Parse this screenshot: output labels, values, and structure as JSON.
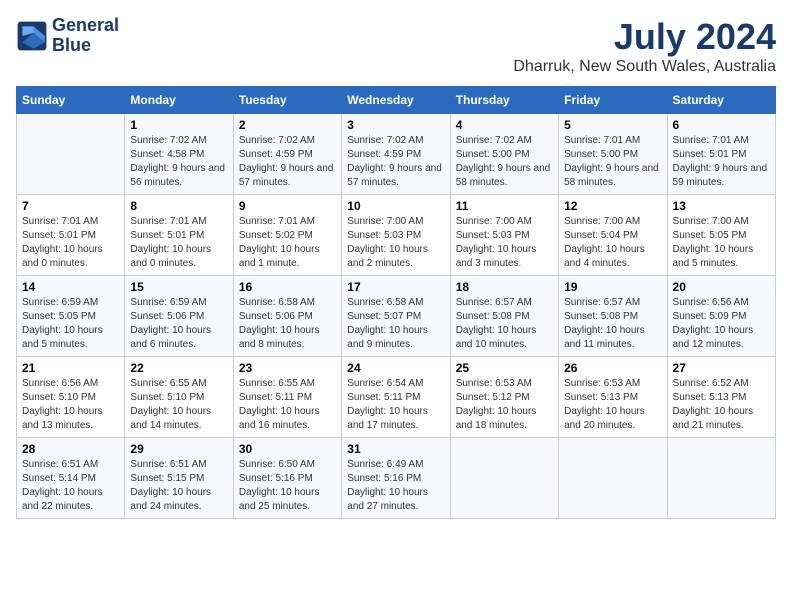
{
  "header": {
    "logo_line1": "General",
    "logo_line2": "Blue",
    "month_title": "July 2024",
    "location": "Dharruk, New South Wales, Australia"
  },
  "weekdays": [
    "Sunday",
    "Monday",
    "Tuesday",
    "Wednesday",
    "Thursday",
    "Friday",
    "Saturday"
  ],
  "weeks": [
    [
      {
        "day": "",
        "sunrise": "",
        "sunset": "",
        "daylight": ""
      },
      {
        "day": "1",
        "sunrise": "Sunrise: 7:02 AM",
        "sunset": "Sunset: 4:58 PM",
        "daylight": "Daylight: 9 hours and 56 minutes."
      },
      {
        "day": "2",
        "sunrise": "Sunrise: 7:02 AM",
        "sunset": "Sunset: 4:59 PM",
        "daylight": "Daylight: 9 hours and 57 minutes."
      },
      {
        "day": "3",
        "sunrise": "Sunrise: 7:02 AM",
        "sunset": "Sunset: 4:59 PM",
        "daylight": "Daylight: 9 hours and 57 minutes."
      },
      {
        "day": "4",
        "sunrise": "Sunrise: 7:02 AM",
        "sunset": "Sunset: 5:00 PM",
        "daylight": "Daylight: 9 hours and 58 minutes."
      },
      {
        "day": "5",
        "sunrise": "Sunrise: 7:01 AM",
        "sunset": "Sunset: 5:00 PM",
        "daylight": "Daylight: 9 hours and 58 minutes."
      },
      {
        "day": "6",
        "sunrise": "Sunrise: 7:01 AM",
        "sunset": "Sunset: 5:01 PM",
        "daylight": "Daylight: 9 hours and 59 minutes."
      }
    ],
    [
      {
        "day": "7",
        "sunrise": "Sunrise: 7:01 AM",
        "sunset": "Sunset: 5:01 PM",
        "daylight": "Daylight: 10 hours and 0 minutes."
      },
      {
        "day": "8",
        "sunrise": "Sunrise: 7:01 AM",
        "sunset": "Sunset: 5:01 PM",
        "daylight": "Daylight: 10 hours and 0 minutes."
      },
      {
        "day": "9",
        "sunrise": "Sunrise: 7:01 AM",
        "sunset": "Sunset: 5:02 PM",
        "daylight": "Daylight: 10 hours and 1 minute."
      },
      {
        "day": "10",
        "sunrise": "Sunrise: 7:00 AM",
        "sunset": "Sunset: 5:03 PM",
        "daylight": "Daylight: 10 hours and 2 minutes."
      },
      {
        "day": "11",
        "sunrise": "Sunrise: 7:00 AM",
        "sunset": "Sunset: 5:03 PM",
        "daylight": "Daylight: 10 hours and 3 minutes."
      },
      {
        "day": "12",
        "sunrise": "Sunrise: 7:00 AM",
        "sunset": "Sunset: 5:04 PM",
        "daylight": "Daylight: 10 hours and 4 minutes."
      },
      {
        "day": "13",
        "sunrise": "Sunrise: 7:00 AM",
        "sunset": "Sunset: 5:05 PM",
        "daylight": "Daylight: 10 hours and 5 minutes."
      }
    ],
    [
      {
        "day": "14",
        "sunrise": "Sunrise: 6:59 AM",
        "sunset": "Sunset: 5:05 PM",
        "daylight": "Daylight: 10 hours and 5 minutes."
      },
      {
        "day": "15",
        "sunrise": "Sunrise: 6:59 AM",
        "sunset": "Sunset: 5:06 PM",
        "daylight": "Daylight: 10 hours and 6 minutes."
      },
      {
        "day": "16",
        "sunrise": "Sunrise: 6:58 AM",
        "sunset": "Sunset: 5:06 PM",
        "daylight": "Daylight: 10 hours and 8 minutes."
      },
      {
        "day": "17",
        "sunrise": "Sunrise: 6:58 AM",
        "sunset": "Sunset: 5:07 PM",
        "daylight": "Daylight: 10 hours and 9 minutes."
      },
      {
        "day": "18",
        "sunrise": "Sunrise: 6:57 AM",
        "sunset": "Sunset: 5:08 PM",
        "daylight": "Daylight: 10 hours and 10 minutes."
      },
      {
        "day": "19",
        "sunrise": "Sunrise: 6:57 AM",
        "sunset": "Sunset: 5:08 PM",
        "daylight": "Daylight: 10 hours and 11 minutes."
      },
      {
        "day": "20",
        "sunrise": "Sunrise: 6:56 AM",
        "sunset": "Sunset: 5:09 PM",
        "daylight": "Daylight: 10 hours and 12 minutes."
      }
    ],
    [
      {
        "day": "21",
        "sunrise": "Sunrise: 6:56 AM",
        "sunset": "Sunset: 5:10 PM",
        "daylight": "Daylight: 10 hours and 13 minutes."
      },
      {
        "day": "22",
        "sunrise": "Sunrise: 6:55 AM",
        "sunset": "Sunset: 5:10 PM",
        "daylight": "Daylight: 10 hours and 14 minutes."
      },
      {
        "day": "23",
        "sunrise": "Sunrise: 6:55 AM",
        "sunset": "Sunset: 5:11 PM",
        "daylight": "Daylight: 10 hours and 16 minutes."
      },
      {
        "day": "24",
        "sunrise": "Sunrise: 6:54 AM",
        "sunset": "Sunset: 5:11 PM",
        "daylight": "Daylight: 10 hours and 17 minutes."
      },
      {
        "day": "25",
        "sunrise": "Sunrise: 6:53 AM",
        "sunset": "Sunset: 5:12 PM",
        "daylight": "Daylight: 10 hours and 18 minutes."
      },
      {
        "day": "26",
        "sunrise": "Sunrise: 6:53 AM",
        "sunset": "Sunset: 5:13 PM",
        "daylight": "Daylight: 10 hours and 20 minutes."
      },
      {
        "day": "27",
        "sunrise": "Sunrise: 6:52 AM",
        "sunset": "Sunset: 5:13 PM",
        "daylight": "Daylight: 10 hours and 21 minutes."
      }
    ],
    [
      {
        "day": "28",
        "sunrise": "Sunrise: 6:51 AM",
        "sunset": "Sunset: 5:14 PM",
        "daylight": "Daylight: 10 hours and 22 minutes."
      },
      {
        "day": "29",
        "sunrise": "Sunrise: 6:51 AM",
        "sunset": "Sunset: 5:15 PM",
        "daylight": "Daylight: 10 hours and 24 minutes."
      },
      {
        "day": "30",
        "sunrise": "Sunrise: 6:50 AM",
        "sunset": "Sunset: 5:16 PM",
        "daylight": "Daylight: 10 hours and 25 minutes."
      },
      {
        "day": "31",
        "sunrise": "Sunrise: 6:49 AM",
        "sunset": "Sunset: 5:16 PM",
        "daylight": "Daylight: 10 hours and 27 minutes."
      },
      {
        "day": "",
        "sunrise": "",
        "sunset": "",
        "daylight": ""
      },
      {
        "day": "",
        "sunrise": "",
        "sunset": "",
        "daylight": ""
      },
      {
        "day": "",
        "sunrise": "",
        "sunset": "",
        "daylight": ""
      }
    ]
  ]
}
